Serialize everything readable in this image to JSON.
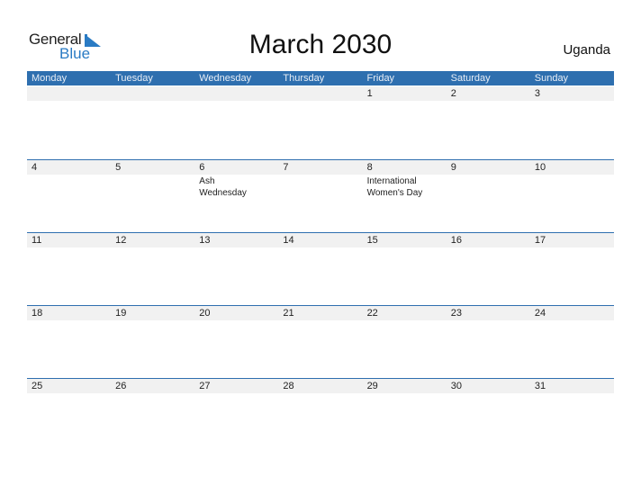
{
  "logo": {
    "word1": "General",
    "word2": "Blue"
  },
  "title": "March 2030",
  "country": "Uganda",
  "colors": {
    "accent": "#2e6faf",
    "logo_blue": "#2a7bc4",
    "strip": "#f1f1f1"
  },
  "weekdays": [
    "Monday",
    "Tuesday",
    "Wednesday",
    "Thursday",
    "Friday",
    "Saturday",
    "Sunday"
  ],
  "weeks": [
    {
      "days": [
        {
          "num": "",
          "event": ""
        },
        {
          "num": "",
          "event": ""
        },
        {
          "num": "",
          "event": ""
        },
        {
          "num": "",
          "event": ""
        },
        {
          "num": "1",
          "event": ""
        },
        {
          "num": "2",
          "event": ""
        },
        {
          "num": "3",
          "event": ""
        }
      ]
    },
    {
      "days": [
        {
          "num": "4",
          "event": ""
        },
        {
          "num": "5",
          "event": ""
        },
        {
          "num": "6",
          "event": "Ash Wednesday"
        },
        {
          "num": "7",
          "event": ""
        },
        {
          "num": "8",
          "event": "International Women's Day"
        },
        {
          "num": "9",
          "event": ""
        },
        {
          "num": "10",
          "event": ""
        }
      ]
    },
    {
      "days": [
        {
          "num": "11",
          "event": ""
        },
        {
          "num": "12",
          "event": ""
        },
        {
          "num": "13",
          "event": ""
        },
        {
          "num": "14",
          "event": ""
        },
        {
          "num": "15",
          "event": ""
        },
        {
          "num": "16",
          "event": ""
        },
        {
          "num": "17",
          "event": ""
        }
      ]
    },
    {
      "days": [
        {
          "num": "18",
          "event": ""
        },
        {
          "num": "19",
          "event": ""
        },
        {
          "num": "20",
          "event": ""
        },
        {
          "num": "21",
          "event": ""
        },
        {
          "num": "22",
          "event": ""
        },
        {
          "num": "23",
          "event": ""
        },
        {
          "num": "24",
          "event": ""
        }
      ]
    },
    {
      "days": [
        {
          "num": "25",
          "event": ""
        },
        {
          "num": "26",
          "event": ""
        },
        {
          "num": "27",
          "event": ""
        },
        {
          "num": "28",
          "event": ""
        },
        {
          "num": "29",
          "event": ""
        },
        {
          "num": "30",
          "event": ""
        },
        {
          "num": "31",
          "event": ""
        }
      ]
    }
  ]
}
